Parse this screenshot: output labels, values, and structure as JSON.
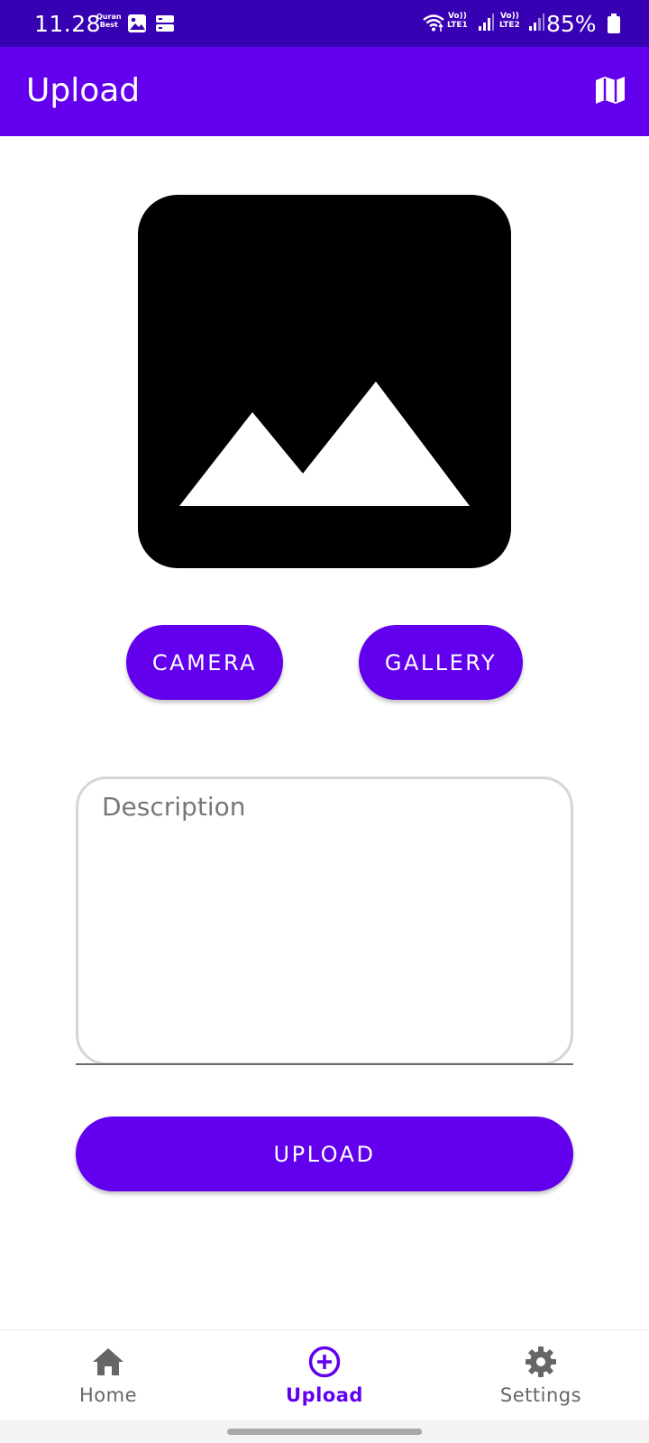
{
  "status_bar": {
    "time": "11.28",
    "quran_badge": "Quran\nBest",
    "sim1_label": "Vo))\nLTE1",
    "sim2_label": "Vo))\nLTE2",
    "battery_percent": "85%"
  },
  "app_bar": {
    "title": "Upload",
    "action_icon": "map-icon"
  },
  "image_preview": {
    "icon": "image-placeholder-icon"
  },
  "buttons": {
    "camera_label": "CAMERA",
    "gallery_label": "GALLERY",
    "upload_label": "UPLOAD"
  },
  "description": {
    "placeholder": "Description",
    "value": ""
  },
  "bottom_nav": {
    "items": [
      {
        "label": "Home",
        "icon": "home-icon",
        "active": false
      },
      {
        "label": "Upload",
        "icon": "add-circle-icon",
        "active": true
      },
      {
        "label": "Settings",
        "icon": "gear-icon",
        "active": false
      }
    ]
  },
  "colors": {
    "status_bar": "#3700B3",
    "primary": "#6200EE",
    "nav_inactive": "#666666"
  }
}
